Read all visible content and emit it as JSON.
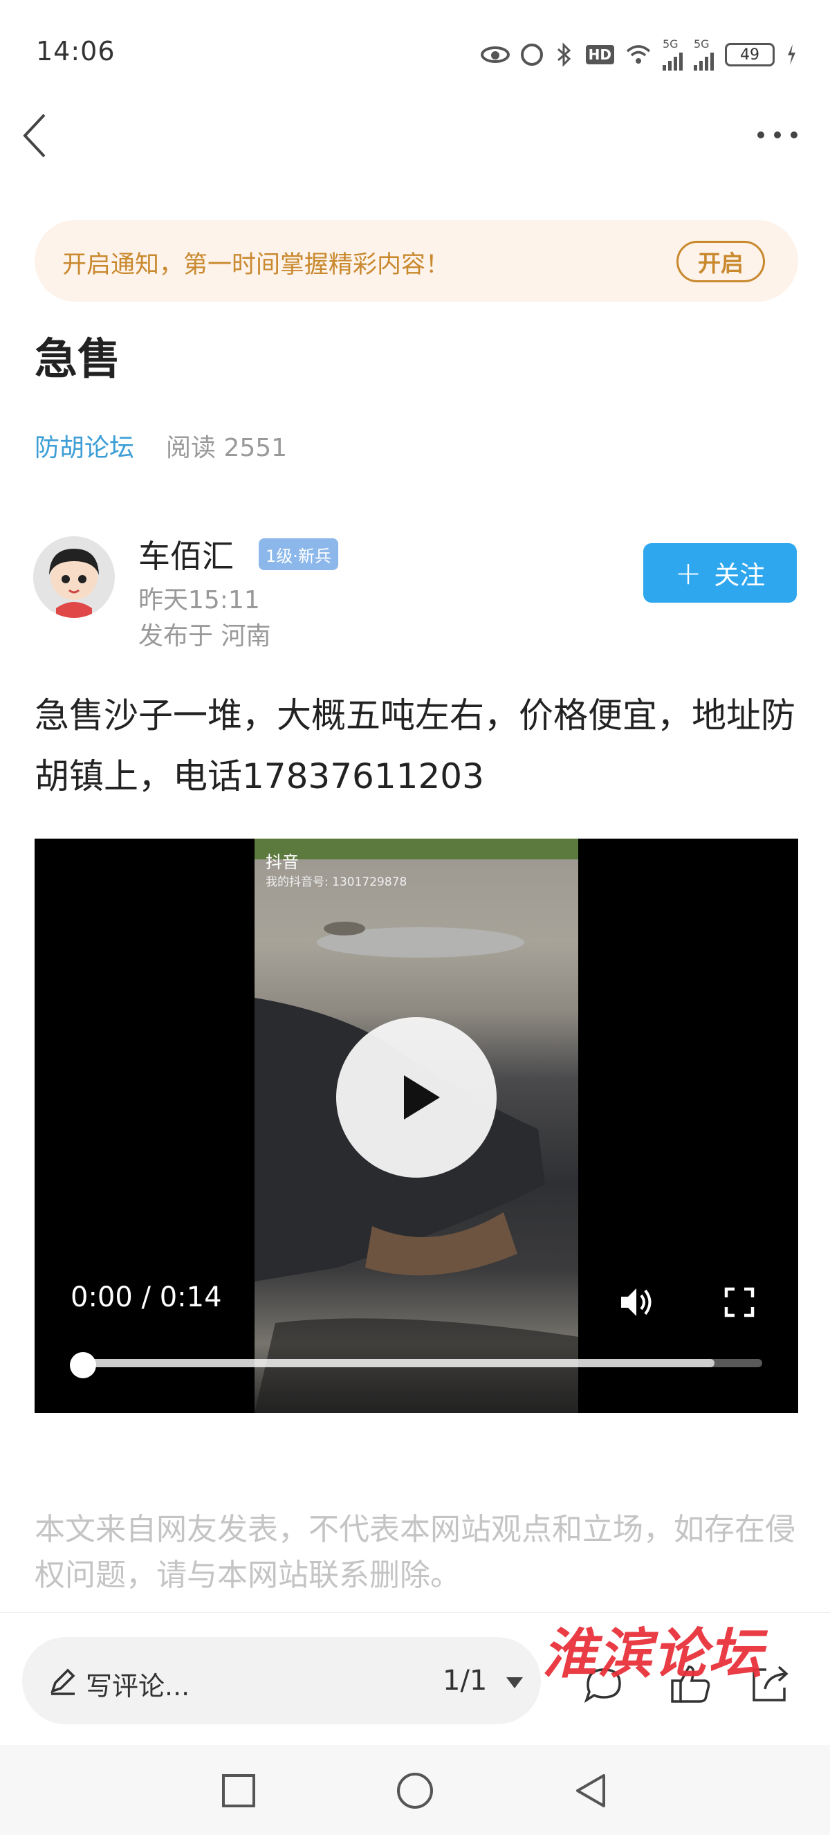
{
  "status_bar": {
    "time": "14:06",
    "hd_label": "HD",
    "sig1_label": "5G",
    "sig2_label": "5G",
    "battery": "49"
  },
  "nav": {
    "back_icon": "chevron-left-icon",
    "more_icon": "more-dots-icon"
  },
  "notify": {
    "text": "开启通知，第一时间掌握精彩内容！",
    "button": "开启",
    "text_color": "#c9892f",
    "bg_color": "#fdf3ea"
  },
  "post": {
    "title": "急售",
    "forum": "防胡论坛",
    "read_count": "阅读 2551",
    "body": "急售沙子一堆，大概五吨左右，价格便宜，地址防胡镇上，电话17837611203"
  },
  "author": {
    "name": "车佰汇",
    "level": "1级·新兵",
    "time": "昨天15:11",
    "location": "发布于 河南",
    "follow_label": "关注",
    "follow_color": "#2ea7ee"
  },
  "video": {
    "watermark_logo": "抖音",
    "watermark_id": "我的抖音号: 1301729878",
    "time_readout": "0:00 / 0:14",
    "buffered_fraction": 0.93,
    "played_fraction": 0.0
  },
  "disclaimer": "本文来自网友发表，不代表本网站观点和立场，如存在侵权问题，请与本网站联系删除。",
  "comment_bar": {
    "placeholder": "写评论...",
    "page": "1/1",
    "brand_stamp": "淮滨论坛"
  }
}
